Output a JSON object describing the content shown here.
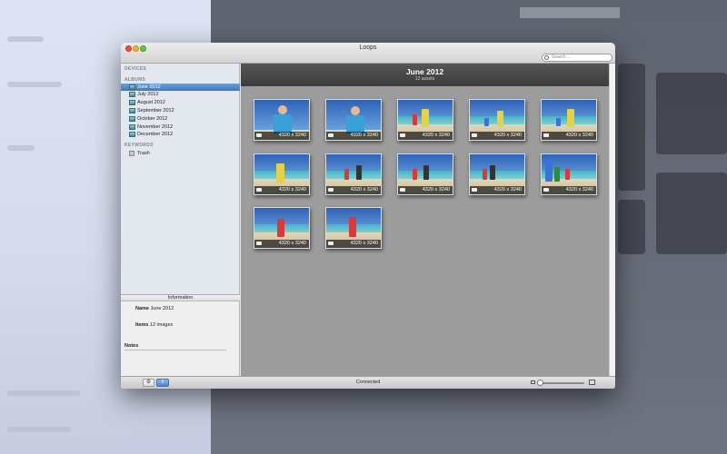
{
  "window": {
    "title": "Loops"
  },
  "search": {
    "placeholder": "Search ..."
  },
  "sidebar": {
    "devices_header": "DEVICES",
    "albums_header": "ALBUMS",
    "albums": [
      "June 2012",
      "July 2012",
      "August 2012",
      "September 2012",
      "October 2012",
      "November 2012",
      "December 2012"
    ],
    "selected_album": "June 2012",
    "keywords_header": "KEYWORDS",
    "trash": "Trash"
  },
  "info": {
    "header": "Information",
    "name_label": "Name",
    "name_value": "June 2012",
    "items_label": "Items",
    "items_value": "12 images",
    "notes_label": "Notes"
  },
  "content": {
    "album_title": "June 2012",
    "asset_count": "12 assets",
    "thumbnails": [
      "4320 x 3240",
      "4320 x 3240",
      "4320 x 3240",
      "4320 x 3240",
      "4320 x 3240",
      "4320 x 3240",
      "4320 x 3240",
      "4320 x 3240",
      "4320 x 3240",
      "4320 x 3240",
      "4320 x 3240",
      "4320 x 3240"
    ]
  },
  "bottombar": {
    "gear_icon": "gear-icon",
    "info_label": "i",
    "status": "Connected"
  },
  "colors": {
    "selection": "#3d78c2",
    "content_bg": "#9d9d9d",
    "header_bg": "#3d3d3d"
  }
}
